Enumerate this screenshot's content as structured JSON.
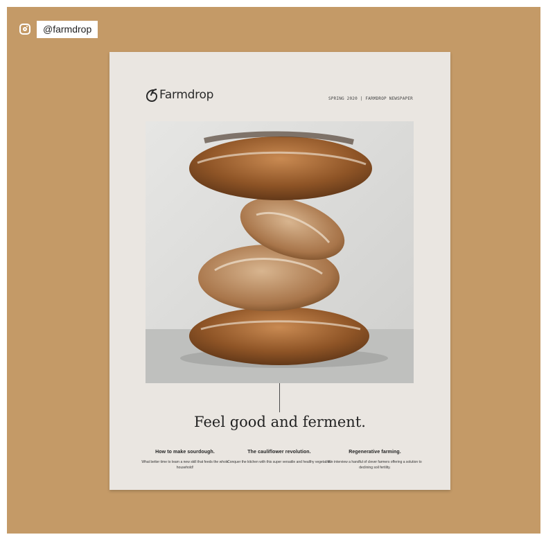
{
  "social": {
    "icon": "instagram-icon",
    "handle": "@farmdrop"
  },
  "newspaper": {
    "brand": "Farmdrop",
    "edition": "SPRING 2020 | FARMDROP NEWSPAPER",
    "headline": "Feel good and ferment.",
    "articles": [
      {
        "title": "How to make sourdough.",
        "blurb": "What better time to learn a new skill that feeds the whole household!"
      },
      {
        "title": "The cauliflower revolution.",
        "blurb": "Conquer the kitchen with this super versatile and healthy vegetable."
      },
      {
        "title": "Regenerative farming.",
        "blurb": "We interview a handful of clever farmers offering a solution to declining soil fertility."
      }
    ]
  },
  "colors": {
    "background": "#c49a67",
    "paper": "#eae6e1",
    "crust": "#9a5a2a"
  }
}
